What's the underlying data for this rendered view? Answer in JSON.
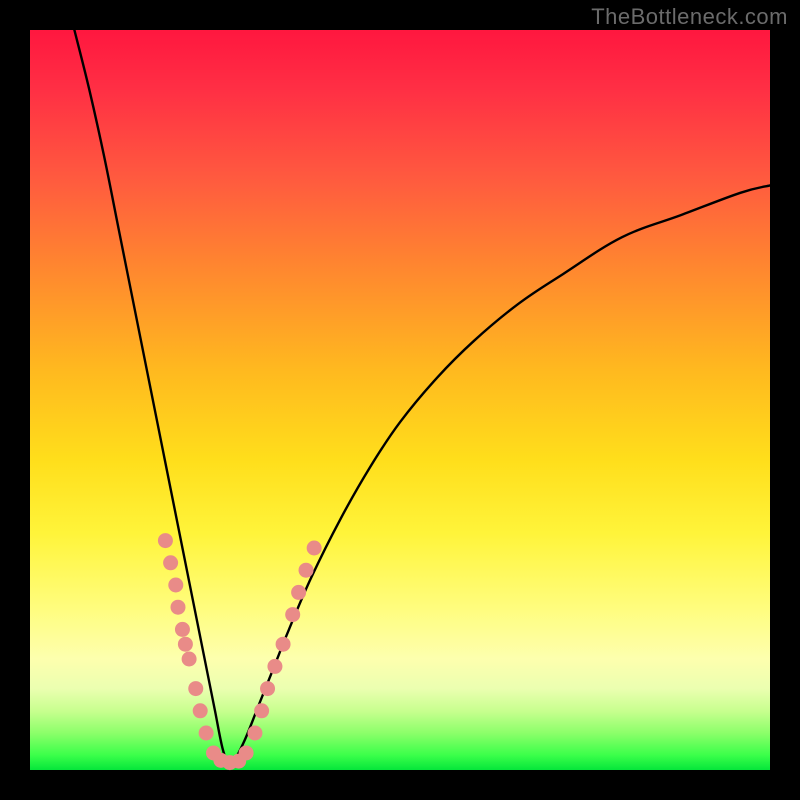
{
  "watermark": {
    "text": "TheBottleneck.com"
  },
  "colors": {
    "background_frame": "#000000",
    "gradient_top": "#ff173f",
    "gradient_mid1": "#ff8a2e",
    "gradient_mid2": "#ffde1b",
    "gradient_mid3": "#fdffae",
    "gradient_bottom": "#05e63b",
    "curve_stroke": "#000000",
    "marker_fill": "#e98b88",
    "marker_stroke": "#b85a57"
  },
  "chart_data": {
    "type": "line",
    "title": "",
    "xlabel": "",
    "ylabel": "",
    "xlim": [
      0,
      100
    ],
    "ylim": [
      0,
      100
    ],
    "notes": "Background vertical gradient encodes badness: red (top, high y) = severe bottleneck, green (bottom, y≈0) = balanced. Two black curves both descend to y≈0 near x≈27 (the optimal point). Left curve falls steeply from top-left; right curve rises from the minimum with diminishing slope toward upper-right. Salmon-colored markers cluster along both curves near the bottom of the V (roughly y ∈ [0, 30]).",
    "series": [
      {
        "name": "left_branch",
        "x": [
          6,
          8,
          10,
          12,
          14,
          16,
          18,
          20,
          21,
          22,
          23,
          24,
          25,
          26,
          27
        ],
        "y": [
          100,
          92,
          83,
          73,
          63,
          53,
          43,
          33,
          28,
          23,
          18,
          13,
          8,
          3,
          0
        ]
      },
      {
        "name": "right_branch",
        "x": [
          27,
          29,
          31,
          33,
          35,
          38,
          42,
          46,
          50,
          55,
          60,
          66,
          72,
          80,
          88,
          96,
          100
        ],
        "y": [
          0,
          4,
          9,
          14,
          19,
          26,
          34,
          41,
          47,
          53,
          58,
          63,
          67,
          72,
          75,
          78,
          79
        ]
      }
    ],
    "markers": [
      {
        "x": 18.3,
        "y": 31
      },
      {
        "x": 19.0,
        "y": 28
      },
      {
        "x": 19.7,
        "y": 25
      },
      {
        "x": 20.0,
        "y": 22
      },
      {
        "x": 20.6,
        "y": 19
      },
      {
        "x": 21.0,
        "y": 17
      },
      {
        "x": 21.5,
        "y": 15
      },
      {
        "x": 22.4,
        "y": 11
      },
      {
        "x": 23.0,
        "y": 8
      },
      {
        "x": 23.8,
        "y": 5
      },
      {
        "x": 24.8,
        "y": 2.3
      },
      {
        "x": 25.8,
        "y": 1.3
      },
      {
        "x": 27.0,
        "y": 1.0
      },
      {
        "x": 28.2,
        "y": 1.2
      },
      {
        "x": 29.2,
        "y": 2.3
      },
      {
        "x": 30.4,
        "y": 5
      },
      {
        "x": 31.3,
        "y": 8
      },
      {
        "x": 32.1,
        "y": 11
      },
      {
        "x": 33.1,
        "y": 14
      },
      {
        "x": 34.2,
        "y": 17
      },
      {
        "x": 35.5,
        "y": 21
      },
      {
        "x": 36.3,
        "y": 24
      },
      {
        "x": 37.3,
        "y": 27
      },
      {
        "x": 38.4,
        "y": 30
      }
    ]
  }
}
